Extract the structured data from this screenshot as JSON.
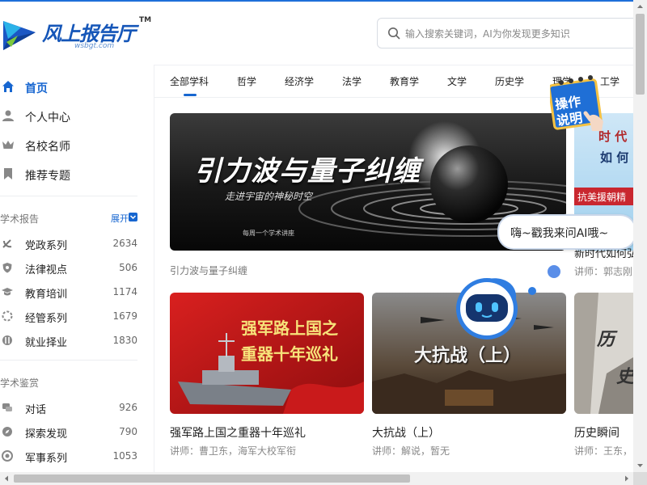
{
  "app": {
    "logo_text": "风上报告厅",
    "logo_tm": "TM",
    "logo_sub": "wsbgt.com"
  },
  "search": {
    "placeholder": "输入搜索关键词，AI为你发现更多知识"
  },
  "sidebar": {
    "nav": [
      {
        "label": "首页",
        "icon": "home-icon",
        "active": true
      },
      {
        "label": "个人中心",
        "icon": "user-icon"
      },
      {
        "label": "名校名师",
        "icon": "crown-icon"
      },
      {
        "label": "推荐专题",
        "icon": "bookmark-icon"
      }
    ],
    "section1": {
      "title": "学术报告",
      "expand_label": "展开",
      "items": [
        {
          "label": "党政系列",
          "count": "2634",
          "icon": "party-emblem-icon"
        },
        {
          "label": "法律视点",
          "count": "506",
          "icon": "shield-icon"
        },
        {
          "label": "教育培训",
          "count": "1174",
          "icon": "graduation-cap-icon"
        },
        {
          "label": "经管系列",
          "count": "1679",
          "icon": "chart-icon"
        },
        {
          "label": "就业择业",
          "count": "1830",
          "icon": "briefcase-icon"
        }
      ]
    },
    "section2": {
      "title": "学术鉴赏",
      "items": [
        {
          "label": "对话",
          "count": "926",
          "icon": "chat-icon"
        },
        {
          "label": "探索发现",
          "count": "790",
          "icon": "compass-icon"
        },
        {
          "label": "军事系列",
          "count": "1053",
          "icon": "military-icon"
        }
      ]
    }
  },
  "tabs": [
    {
      "label": "全部学科",
      "active": true
    },
    {
      "label": "哲学"
    },
    {
      "label": "经济学"
    },
    {
      "label": "法学"
    },
    {
      "label": "教育学"
    },
    {
      "label": "文学"
    },
    {
      "label": "历史学"
    },
    {
      "label": "理学"
    },
    {
      "label": "工学"
    }
  ],
  "banner": {
    "title": "引力波与量子纠缠",
    "subtitle": "走进宇宙的神秘时空",
    "small": "每周一个学术讲座",
    "caption": "引力波与量子纠缠"
  },
  "side_card": {
    "line1": "时 代",
    "line2": "如 何",
    "line3": "抗美援朝精",
    "title": "新时代如何弘",
    "lecturer": "讲师：郭志刚"
  },
  "op_guide": {
    "line1": "操作",
    "line2": "说明"
  },
  "ai_bubble": "嗨~戳我来问AI哦~",
  "cards": [
    {
      "image_text_1": "强军路上国之",
      "image_text_2": "重器十年巡礼",
      "title": "强军路上国之重器十年巡礼",
      "lecturer": "讲师：曹卫东，海军大校军衔"
    },
    {
      "image_text_1": "大抗战（上）",
      "image_text_2": "",
      "title": "大抗战（上）",
      "lecturer": "讲师：解说，暂无"
    },
    {
      "image_text_1": "历",
      "image_text_2": "史",
      "title": "历史瞬间",
      "lecturer": "讲师：王东，"
    }
  ],
  "colors": {
    "accent": "#1766d0",
    "robot": "#2f7de1"
  }
}
